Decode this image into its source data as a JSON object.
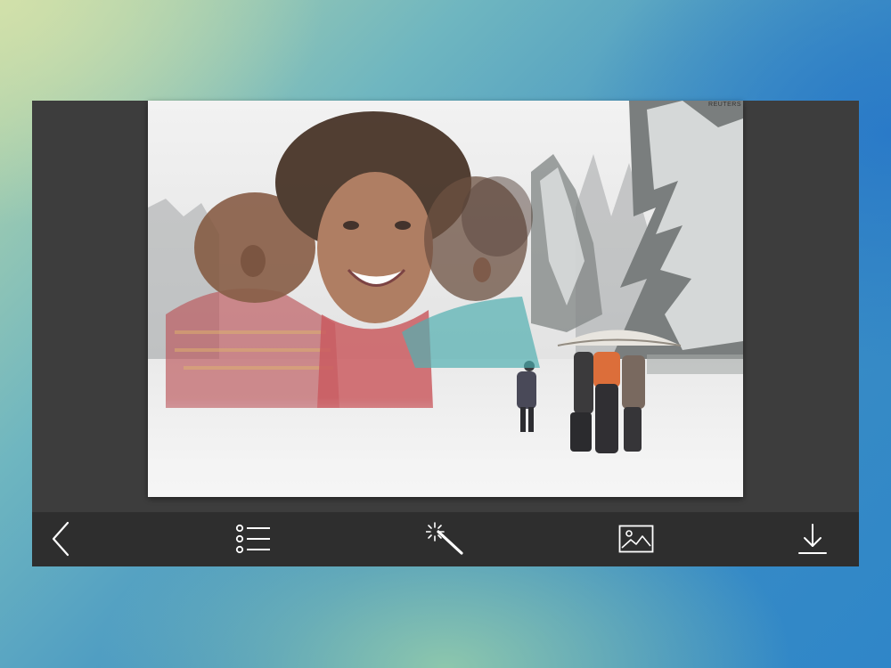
{
  "photo": {
    "watermark": "REUTERS"
  },
  "toolbar": {
    "items": [
      {
        "id": "back",
        "icon": "chevron-left-icon"
      },
      {
        "id": "frames",
        "icon": "list-icon"
      },
      {
        "id": "effects",
        "icon": "magic-wand-icon"
      },
      {
        "id": "gallery",
        "icon": "image-icon"
      },
      {
        "id": "save",
        "icon": "download-icon"
      }
    ]
  },
  "colors": {
    "toolbar_bg": "#2e2e2e",
    "panel_bg": "#3d3d3d",
    "icon_color": "#ffffff"
  }
}
